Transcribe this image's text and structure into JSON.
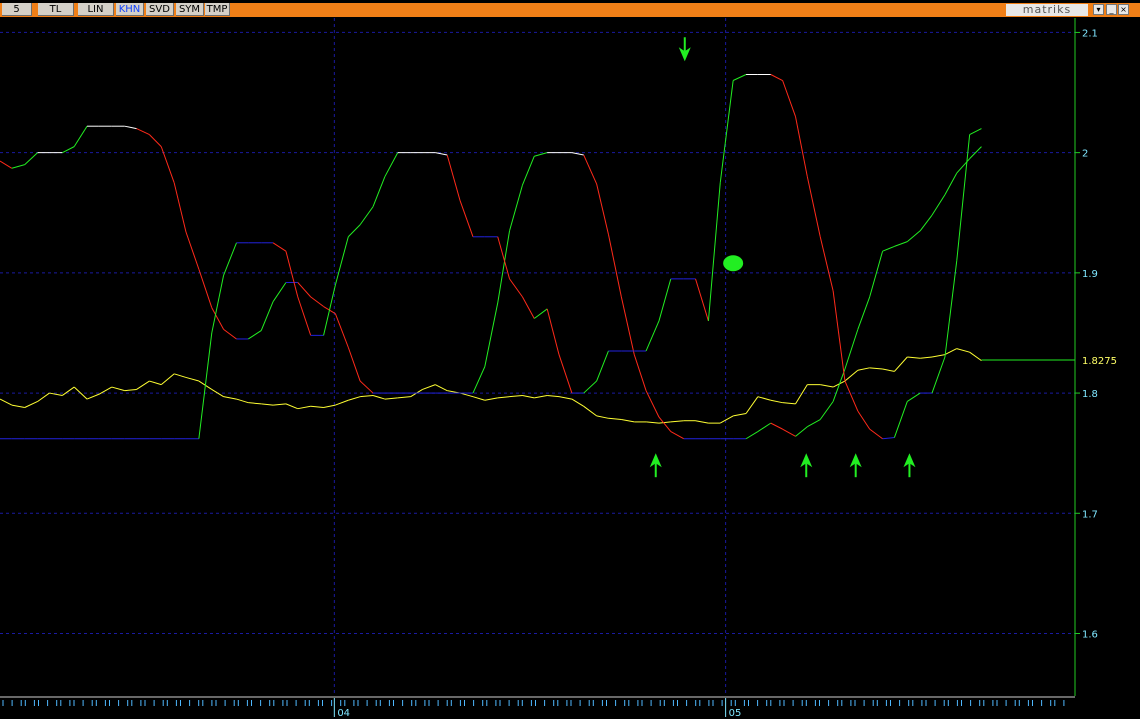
{
  "toolbar": {
    "buttons": [
      {
        "label": "5",
        "active": false
      },
      {
        "label": "TL",
        "active": false
      },
      {
        "label": "LIN",
        "active": false
      },
      {
        "label": "KHN",
        "active": true
      },
      {
        "label": "SVD",
        "active": false
      },
      {
        "label": "SYM",
        "active": false
      },
      {
        "label": "TMP",
        "active": false
      }
    ],
    "brand": "matriks",
    "color": "#f07f17"
  },
  "chart_data": {
    "type": "line",
    "ylim": [
      1.548,
      2.112
    ],
    "y_ticks": [
      1.6,
      1.7,
      1.8,
      1.9,
      2,
      2.1
    ],
    "y_tick_labels": [
      "1.6",
      "1.7",
      "1.8",
      "1.9",
      "2",
      "2.1"
    ],
    "last_value": "1.8275",
    "x_labels": [
      "04",
      "05"
    ],
    "grid": true,
    "colors": {
      "price": "#ffff33",
      "up_line": "#22ee22",
      "down_line": "#ff2a1a",
      "flat_line": "#2222dd",
      "peak_line": "#ffffff",
      "grid": "#1a1aa0",
      "axis": "#22cc22",
      "marker": "#22ee22"
    },
    "series": [
      {
        "role": "price",
        "x": [
          0,
          0.011,
          0.023,
          0.035,
          0.046,
          0.058,
          0.069,
          0.081,
          0.092,
          0.104,
          0.116,
          0.127,
          0.139,
          0.15,
          0.162,
          0.173,
          0.185,
          0.197,
          0.208,
          0.22,
          0.231,
          0.243,
          0.254,
          0.266,
          0.277,
          0.289,
          0.301,
          0.312,
          0.324,
          0.335,
          0.347,
          0.358,
          0.37,
          0.382,
          0.393,
          0.405,
          0.416,
          0.428,
          0.44,
          0.451,
          0.463,
          0.474,
          0.486,
          0.497,
          0.509,
          0.52,
          0.532,
          0.543,
          0.555,
          0.566,
          0.578,
          0.59,
          0.601,
          0.613,
          0.624,
          0.636,
          0.647,
          0.659,
          0.67,
          0.682,
          0.694,
          0.705,
          0.717,
          0.728,
          0.74,
          0.751,
          0.763,
          0.775,
          0.786,
          0.798,
          0.809,
          0.821,
          0.832,
          0.844,
          0.856,
          0.867,
          0.879,
          0.89,
          0.902,
          0.913
        ],
        "y": [
          1.795,
          1.79,
          1.788,
          1.793,
          1.8,
          1.798,
          1.805,
          1.795,
          1.799,
          1.805,
          1.802,
          1.803,
          1.81,
          1.807,
          1.816,
          1.813,
          1.81,
          1.803,
          1.797,
          1.795,
          1.792,
          1.791,
          1.79,
          1.791,
          1.787,
          1.789,
          1.788,
          1.79,
          1.794,
          1.797,
          1.798,
          1.795,
          1.796,
          1.797,
          1.803,
          1.807,
          1.802,
          1.8,
          1.797,
          1.794,
          1.796,
          1.797,
          1.798,
          1.796,
          1.798,
          1.797,
          1.795,
          1.789,
          1.781,
          1.779,
          1.778,
          1.776,
          1.776,
          1.775,
          1.776,
          1.777,
          1.777,
          1.775,
          1.775,
          1.781,
          1.783,
          1.797,
          1.794,
          1.792,
          1.791,
          1.807,
          1.807,
          1.805,
          1.81,
          1.819,
          1.821,
          1.82,
          1.818,
          1.83,
          1.829,
          1.83,
          1.832,
          1.837,
          1.834,
          1.827
        ]
      },
      {
        "role": "upper",
        "x": [
          0,
          0.011,
          0.023,
          0.035,
          0.046,
          0.058,
          0.069,
          0.081,
          0.092,
          0.104,
          0.116,
          0.127,
          0.139,
          0.15,
          0.162,
          0.173,
          0.185,
          0.197,
          0.208,
          0.22,
          0.231,
          0.243,
          0.254,
          0.266,
          0.277,
          0.289,
          0.301,
          0.312,
          0.324,
          0.335,
          0.347,
          0.358,
          0.37,
          0.382,
          0.393,
          0.405,
          0.416,
          0.428,
          0.44,
          0.451,
          0.463,
          0.474,
          0.486,
          0.497,
          0.509,
          0.52,
          0.532,
          0.543,
          0.555,
          0.566,
          0.578,
          0.59,
          0.601,
          0.613,
          0.624,
          0.636,
          0.647,
          0.659,
          0.67,
          0.682,
          0.694,
          0.705,
          0.717,
          0.728,
          0.74,
          0.751,
          0.763,
          0.775,
          0.786,
          0.798,
          0.809,
          0.821,
          0.832,
          0.844,
          0.856,
          0.867,
          0.879,
          0.89,
          0.902,
          0.913
        ],
        "y": [
          1.993,
          1.987,
          1.99,
          2,
          2,
          2,
          2.005,
          2.022,
          2.022,
          2.022,
          2.022,
          2.02,
          2.015,
          2.005,
          1.975,
          1.934,
          1.903,
          1.871,
          1.853,
          1.845,
          1.845,
          1.852,
          1.876,
          1.892,
          1.892,
          1.88,
          1.872,
          1.866,
          1.838,
          1.81,
          1.8,
          1.8,
          1.8,
          1.8,
          1.8,
          1.8,
          1.8,
          1.8,
          1.8,
          1.822,
          1.875,
          1.935,
          1.973,
          1.997,
          2,
          2,
          2,
          1.998,
          1.974,
          1.932,
          1.88,
          1.832,
          1.802,
          1.78,
          1.768,
          1.762,
          1.762,
          1.762,
          1.762,
          1.762,
          1.762,
          1.768,
          1.775,
          1.77,
          1.764,
          1.772,
          1.778,
          1.793,
          1.82,
          1.853,
          1.88,
          1.918,
          1.922,
          1.926,
          1.935,
          1.948,
          1.965,
          1.983,
          1.995,
          2.005
        ]
      },
      {
        "role": "lower",
        "x": [
          0,
          0.011,
          0.023,
          0.035,
          0.046,
          0.058,
          0.069,
          0.081,
          0.092,
          0.104,
          0.116,
          0.127,
          0.139,
          0.15,
          0.162,
          0.173,
          0.185,
          0.197,
          0.208,
          0.22,
          0.231,
          0.243,
          0.254,
          0.266,
          0.277,
          0.289,
          0.301,
          0.312,
          0.324,
          0.335,
          0.347,
          0.358,
          0.37,
          0.382,
          0.393,
          0.405,
          0.416,
          0.428,
          0.44,
          0.451,
          0.463,
          0.474,
          0.486,
          0.497,
          0.509,
          0.52,
          0.532,
          0.543,
          0.555,
          0.566,
          0.578,
          0.59,
          0.601,
          0.613,
          0.624,
          0.636,
          0.647,
          0.659,
          0.67,
          0.682,
          0.694,
          0.705,
          0.717,
          0.728,
          0.74,
          0.751,
          0.763,
          0.775,
          0.786,
          0.798,
          0.809,
          0.821,
          0.832,
          0.844,
          0.856,
          0.867,
          0.879,
          0.89,
          0.902,
          0.913
        ],
        "y": [
          1.762,
          1.762,
          1.762,
          1.762,
          1.762,
          1.762,
          1.762,
          1.762,
          1.762,
          1.762,
          1.762,
          1.762,
          1.762,
          1.762,
          1.762,
          1.762,
          1.762,
          1.85,
          1.898,
          1.925,
          1.925,
          1.925,
          1.925,
          1.918,
          1.88,
          1.848,
          1.848,
          1.89,
          1.93,
          1.94,
          1.955,
          1.98,
          2,
          2,
          2,
          2,
          1.998,
          1.96,
          1.93,
          1.93,
          1.93,
          1.895,
          1.88,
          1.862,
          1.87,
          1.832,
          1.8,
          1.8,
          1.81,
          1.835,
          1.835,
          1.835,
          1.835,
          1.86,
          1.895,
          1.895,
          1.895,
          1.86,
          1.975,
          2.06,
          2.065,
          2.065,
          2.065,
          2.06,
          2.03,
          1.98,
          1.93,
          1.885,
          1.81,
          1.785,
          1.77,
          1.762,
          1.763,
          1.793,
          1.8,
          1.8,
          1.83,
          1.91,
          2.015,
          2.02
        ]
      }
    ],
    "markers": [
      {
        "type": "arrow-down",
        "x": 0.637,
        "y": 2.086
      },
      {
        "type": "circle",
        "x": 0.682,
        "y": 1.908
      },
      {
        "type": "arrow-up",
        "x": 0.61,
        "y": 1.74
      },
      {
        "type": "arrow-up",
        "x": 0.75,
        "y": 1.74
      },
      {
        "type": "arrow-up",
        "x": 0.796,
        "y": 1.74
      },
      {
        "type": "arrow-up",
        "x": 0.846,
        "y": 1.74
      }
    ]
  }
}
